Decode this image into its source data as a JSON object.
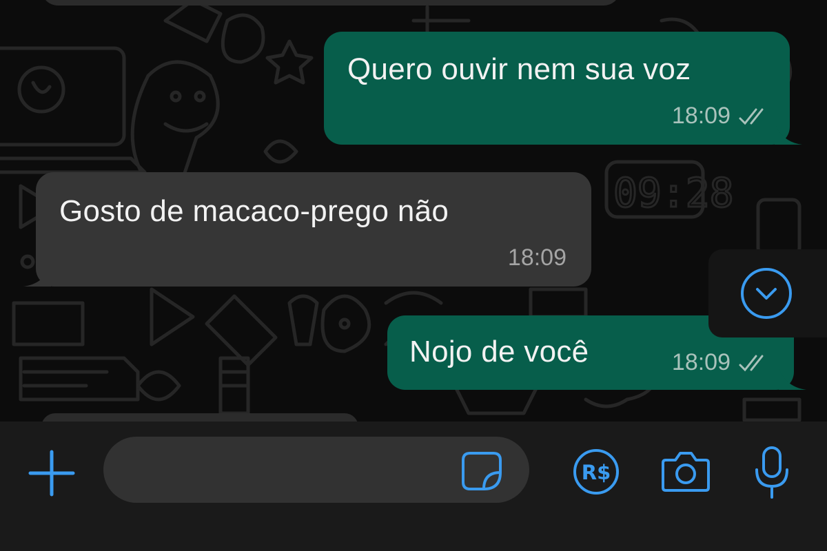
{
  "messages": [
    {
      "direction": "outgoing",
      "text": "Quero ouvir nem sua voz",
      "time": "18:09",
      "status": "read"
    },
    {
      "direction": "incoming",
      "text": "Gosto de macaco-prego não",
      "time": "18:09"
    },
    {
      "direction": "outgoing",
      "text": "Nojo de você",
      "time": "18:09",
      "status": "read"
    }
  ],
  "wallpaper_clock": "09:28",
  "scroll_down_icon": "chevron-down-circle-icon",
  "composer": {
    "placeholder": "",
    "attach_icon": "plus-icon",
    "sticker_icon": "sticker-icon",
    "pay_icon_label": "R$",
    "camera_icon": "camera-icon",
    "mic_icon": "microphone-icon"
  },
  "colors": {
    "outgoing_bubble": "#075e4b",
    "incoming_bubble": "#363636",
    "accent": "#3a9bf0",
    "background": "#0c0c0c"
  }
}
